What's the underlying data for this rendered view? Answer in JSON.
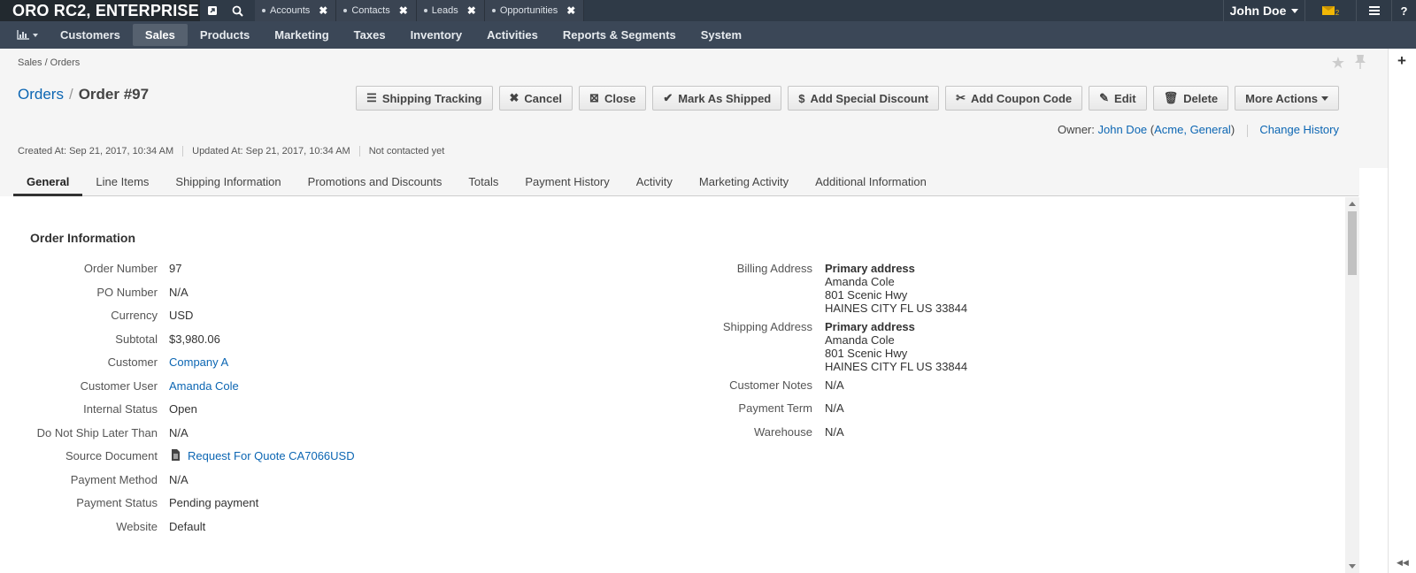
{
  "topbar": {
    "app_title": "ORO RC2, ENTERPRISE",
    "pinned_tabs": [
      "Accounts",
      "Contacts",
      "Leads",
      "Opportunities"
    ],
    "user_name": "John Doe",
    "mail_count": "2"
  },
  "nav": {
    "items": [
      "Customers",
      "Sales",
      "Products",
      "Marketing",
      "Taxes",
      "Inventory",
      "Activities",
      "Reports & Segments",
      "System"
    ],
    "active": "Sales"
  },
  "breadcrumb": "Sales / Orders",
  "title": {
    "parent": "Orders",
    "separator": "/",
    "current": "Order #97"
  },
  "actions": {
    "shipping_tracking": "Shipping Tracking",
    "cancel": "Cancel",
    "close": "Close",
    "mark_as_shipped": "Mark As Shipped",
    "add_special_discount": "Add Special Discount",
    "add_coupon_code": "Add Coupon Code",
    "edit": "Edit",
    "delete": "Delete",
    "more_actions": "More Actions"
  },
  "owner": {
    "label": "Owner:",
    "name": "John Doe",
    "org": "Acme, General",
    "change_history": "Change History"
  },
  "meta": {
    "created": "Created At: Sep 21, 2017, 10:34 AM",
    "updated": "Updated At: Sep 21, 2017, 10:34 AM",
    "contacted": "Not contacted yet"
  },
  "tabs": [
    "General",
    "Line Items",
    "Shipping Information",
    "Promotions and Discounts",
    "Totals",
    "Payment History",
    "Activity",
    "Marketing Activity",
    "Additional Information"
  ],
  "order_info": {
    "title": "Order Information",
    "left": [
      {
        "label": "Order Number",
        "value": "97"
      },
      {
        "label": "PO Number",
        "value": "N/A"
      },
      {
        "label": "Currency",
        "value": "USD"
      },
      {
        "label": "Subtotal",
        "value": "$3,980.06"
      },
      {
        "label": "Customer",
        "value": "Company A"
      },
      {
        "label": "Customer User",
        "value": "Amanda Cole"
      },
      {
        "label": "Internal Status",
        "value": "Open"
      },
      {
        "label": "Do Not Ship Later Than",
        "value": "N/A"
      },
      {
        "label": "Source Document",
        "value": "Request For Quote CA7066USD"
      },
      {
        "label": "Payment Method",
        "value": "N/A"
      },
      {
        "label": "Payment Status",
        "value": "Pending payment"
      },
      {
        "label": "Website",
        "value": "Default"
      }
    ],
    "billing": {
      "label": "Billing Address",
      "title": "Primary address",
      "name": "Amanda Cole",
      "street": "801 Scenic Hwy",
      "city": "HAINES CITY FL US 33844"
    },
    "shipping": {
      "label": "Shipping Address",
      "title": "Primary address",
      "name": "Amanda Cole",
      "street": "801 Scenic Hwy",
      "city": "HAINES CITY FL US 33844"
    },
    "right": [
      {
        "label": "Customer Notes",
        "value": "N/A"
      },
      {
        "label": "Payment Term",
        "value": "N/A"
      },
      {
        "label": "Warehouse",
        "value": "N/A"
      }
    ]
  },
  "colors": {
    "topbar": "#2f3a47",
    "nav": "#3b4757",
    "link": "#0c66b3"
  }
}
